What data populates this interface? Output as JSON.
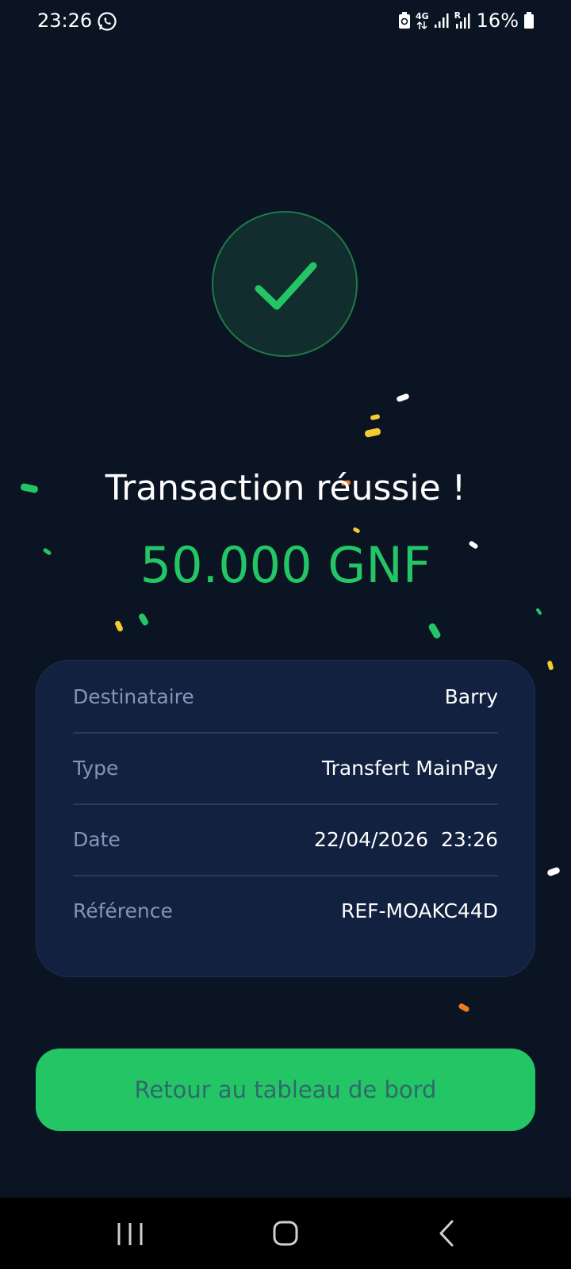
{
  "status_bar": {
    "time": "23:26",
    "network": "4G",
    "roaming": "R",
    "battery": "16%",
    "icons": [
      "whatsapp-icon",
      "battery-saver-icon",
      "data-arrows-icon",
      "signal-icon",
      "roaming-signal-icon",
      "battery-icon"
    ]
  },
  "success": {
    "icon": "check-icon",
    "title": "Transaction réussie !",
    "amount": "50.000 GNF"
  },
  "details": [
    {
      "label": "Destinataire",
      "value": "Barry"
    },
    {
      "label": "Type",
      "value": "Transfert MainPay"
    },
    {
      "label": "Date",
      "value": "22/04/2026  23:26"
    },
    {
      "label": "Référence",
      "value": "REF-MOAKC44D"
    }
  ],
  "button": {
    "label": "Retour au tableau de bord"
  },
  "nav": {
    "icons": [
      "recent-apps-icon",
      "home-icon",
      "back-icon"
    ]
  },
  "colors": {
    "background": "#0b1423",
    "accent_green": "#24c565",
    "card": "#11213f",
    "label": "#8195b5",
    "button_text": "#2f6a6c",
    "confetti_yellow": "#f4cc2f",
    "confetti_orange": "#f07a1e",
    "confetti_white": "#ffffff"
  }
}
